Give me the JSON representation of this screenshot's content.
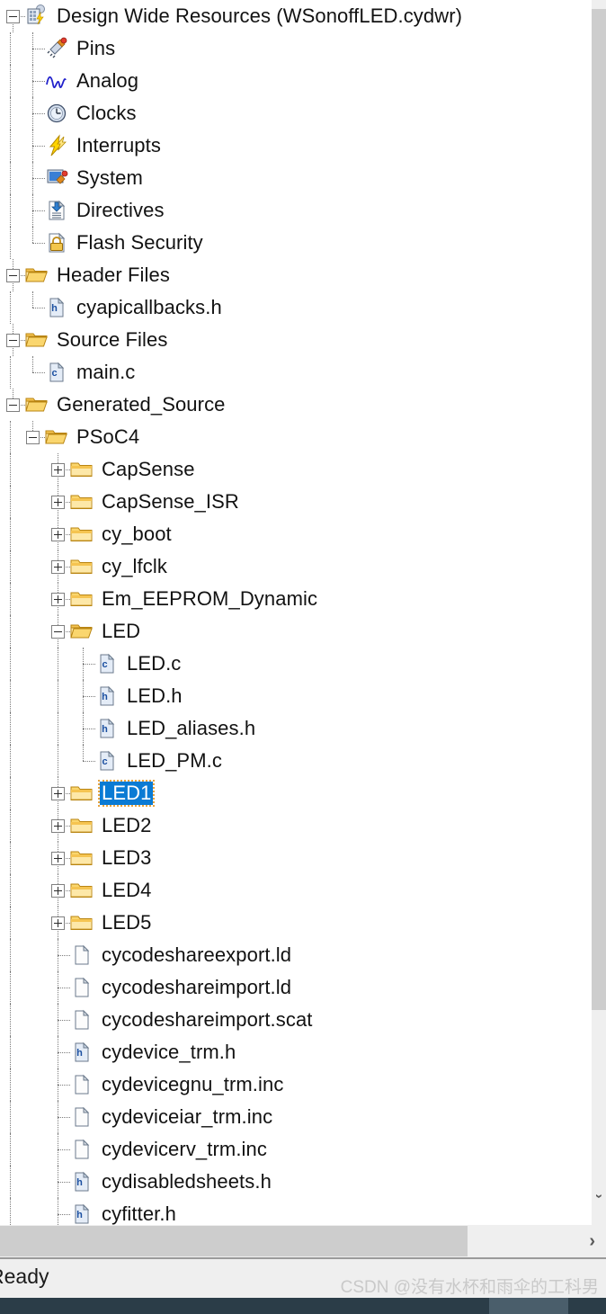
{
  "window": {
    "panel_name": "workspace-explorer-tree"
  },
  "tree": {
    "items": [
      {
        "label": "Design Wide Resources (WSonoffLED.cydwr)",
        "depth": 0,
        "icon": "dwr-chip-icon",
        "toggle": "minus",
        "selected": false,
        "connector": "root"
      },
      {
        "label": "Pins",
        "depth": 1,
        "icon": "pins-icon",
        "toggle": "none",
        "selected": false,
        "connector": "tee"
      },
      {
        "label": "Analog",
        "depth": 1,
        "icon": "analog-wave-icon",
        "toggle": "none",
        "selected": false,
        "connector": "tee"
      },
      {
        "label": "Clocks",
        "depth": 1,
        "icon": "clock-icon",
        "toggle": "none",
        "selected": false,
        "connector": "tee"
      },
      {
        "label": "Interrupts",
        "depth": 1,
        "icon": "interrupt-bolt-icon",
        "toggle": "none",
        "selected": false,
        "connector": "tee"
      },
      {
        "label": "System",
        "depth": 1,
        "icon": "system-icon",
        "toggle": "none",
        "selected": false,
        "connector": "tee"
      },
      {
        "label": "Directives",
        "depth": 1,
        "icon": "directives-icon",
        "toggle": "none",
        "selected": false,
        "connector": "tee"
      },
      {
        "label": "Flash Security",
        "depth": 1,
        "icon": "flash-security-lock-icon",
        "toggle": "none",
        "selected": false,
        "connector": "last"
      },
      {
        "label": "Header Files",
        "depth": 0,
        "icon": "folder-open-icon",
        "toggle": "minus",
        "selected": false,
        "connector": "root"
      },
      {
        "label": "cyapicallbacks.h",
        "depth": 1,
        "icon": "file-h-icon",
        "toggle": "none",
        "selected": false,
        "connector": "last"
      },
      {
        "label": "Source Files",
        "depth": 0,
        "icon": "folder-open-icon",
        "toggle": "minus",
        "selected": false,
        "connector": "root"
      },
      {
        "label": "main.c",
        "depth": 1,
        "icon": "file-c-icon",
        "toggle": "none",
        "selected": false,
        "connector": "last"
      },
      {
        "label": "Generated_Source",
        "depth": 0,
        "icon": "folder-open-icon",
        "toggle": "minus",
        "selected": false,
        "connector": "root"
      },
      {
        "label": "PSoC4",
        "depth": 1,
        "icon": "folder-open-icon",
        "toggle": "minus",
        "selected": false,
        "connector": "tee"
      },
      {
        "label": "CapSense",
        "depth": 2,
        "icon": "folder-closed-icon",
        "toggle": "plus",
        "selected": false,
        "connector": "tee"
      },
      {
        "label": "CapSense_ISR",
        "depth": 2,
        "icon": "folder-closed-icon",
        "toggle": "plus",
        "selected": false,
        "connector": "tee"
      },
      {
        "label": "cy_boot",
        "depth": 2,
        "icon": "folder-closed-icon",
        "toggle": "plus",
        "selected": false,
        "connector": "tee"
      },
      {
        "label": "cy_lfclk",
        "depth": 2,
        "icon": "folder-closed-icon",
        "toggle": "plus",
        "selected": false,
        "connector": "tee"
      },
      {
        "label": "Em_EEPROM_Dynamic",
        "depth": 2,
        "icon": "folder-closed-icon",
        "toggle": "plus",
        "selected": false,
        "connector": "tee"
      },
      {
        "label": "LED",
        "depth": 2,
        "icon": "folder-open-icon",
        "toggle": "minus",
        "selected": false,
        "connector": "tee"
      },
      {
        "label": "LED.c",
        "depth": 3,
        "icon": "file-c-icon",
        "toggle": "none",
        "selected": false,
        "connector": "tee"
      },
      {
        "label": "LED.h",
        "depth": 3,
        "icon": "file-h-icon",
        "toggle": "none",
        "selected": false,
        "connector": "tee"
      },
      {
        "label": "LED_aliases.h",
        "depth": 3,
        "icon": "file-h-icon",
        "toggle": "none",
        "selected": false,
        "connector": "tee"
      },
      {
        "label": "LED_PM.c",
        "depth": 3,
        "icon": "file-c-icon",
        "toggle": "none",
        "selected": false,
        "connector": "last"
      },
      {
        "label": "LED1",
        "depth": 2,
        "icon": "folder-closed-icon",
        "toggle": "plus",
        "selected": true,
        "connector": "tee"
      },
      {
        "label": "LED2",
        "depth": 2,
        "icon": "folder-closed-icon",
        "toggle": "plus",
        "selected": false,
        "connector": "tee"
      },
      {
        "label": "LED3",
        "depth": 2,
        "icon": "folder-closed-icon",
        "toggle": "plus",
        "selected": false,
        "connector": "tee"
      },
      {
        "label": "LED4",
        "depth": 2,
        "icon": "folder-closed-icon",
        "toggle": "plus",
        "selected": false,
        "connector": "tee"
      },
      {
        "label": "LED5",
        "depth": 2,
        "icon": "folder-closed-icon",
        "toggle": "plus",
        "selected": false,
        "connector": "tee"
      },
      {
        "label": "cycodeshareexport.ld",
        "depth": 2,
        "icon": "file-blank-icon",
        "toggle": "none",
        "selected": false,
        "connector": "tee"
      },
      {
        "label": "cycodeshareimport.ld",
        "depth": 2,
        "icon": "file-blank-icon",
        "toggle": "none",
        "selected": false,
        "connector": "tee"
      },
      {
        "label": "cycodeshareimport.scat",
        "depth": 2,
        "icon": "file-blank-icon",
        "toggle": "none",
        "selected": false,
        "connector": "tee"
      },
      {
        "label": "cydevice_trm.h",
        "depth": 2,
        "icon": "file-h-icon",
        "toggle": "none",
        "selected": false,
        "connector": "tee"
      },
      {
        "label": "cydevicegnu_trm.inc",
        "depth": 2,
        "icon": "file-blank-icon",
        "toggle": "none",
        "selected": false,
        "connector": "tee"
      },
      {
        "label": "cydeviceiar_trm.inc",
        "depth": 2,
        "icon": "file-blank-icon",
        "toggle": "none",
        "selected": false,
        "connector": "tee"
      },
      {
        "label": "cydevicerv_trm.inc",
        "depth": 2,
        "icon": "file-blank-icon",
        "toggle": "none",
        "selected": false,
        "connector": "tee"
      },
      {
        "label": "cydisabledsheets.h",
        "depth": 2,
        "icon": "file-h-icon",
        "toggle": "none",
        "selected": false,
        "connector": "tee"
      },
      {
        "label": "cyfitter.h",
        "depth": 2,
        "icon": "file-h-icon",
        "toggle": "none",
        "selected": false,
        "connector": "tee"
      }
    ]
  },
  "scrollbars": {
    "vertical_chevron": "›",
    "horizontal_chevron": "›"
  },
  "statusbar": {
    "text": "Ready",
    "watermark": "CSDN @没有水杯和雨伞的工科男"
  },
  "colors": {
    "selection_blue": "#0a7bd4",
    "focus_outline": "#e8a33d",
    "scroll_thumb": "#cdcdcd",
    "scroll_track": "#efefef",
    "statusbar_bg": "#efefef",
    "bottom_strip": "#2b3d48",
    "text": "#121212"
  }
}
